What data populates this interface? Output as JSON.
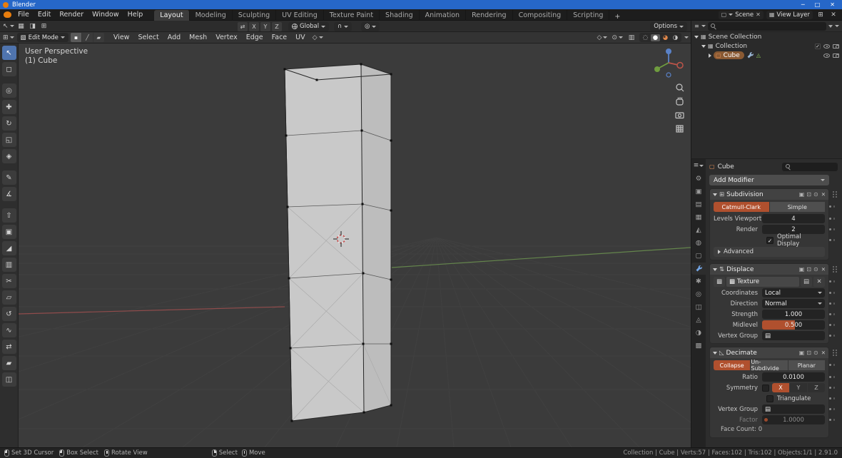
{
  "window": {
    "title": "Blender"
  },
  "icons": {
    "minimize": "─",
    "maximize": "□",
    "close": "✕",
    "check": "✓",
    "editor_menu": "≡",
    "editor_3d": "⊞",
    "collection": "▦",
    "object": "▢",
    "mesh_data": "◬",
    "mode_cube": "▧",
    "select_modes": [
      "▪",
      "╱",
      "▰"
    ],
    "mirror_tool": "⇄",
    "magnet": "∩",
    "proportional": "◎",
    "gizmo": "◇",
    "overlay": "⊙",
    "xray": "▥",
    "shading": [
      "◌",
      "●",
      "◕",
      "◑"
    ],
    "ts_icons": [
      "▦",
      "◨",
      "⊞"
    ],
    "tb_extra": [
      "▢",
      "▦"
    ],
    "tools": [
      "↖",
      "◻",
      "◎",
      "✚",
      "↻",
      "◱",
      "◈",
      "✎",
      "∡",
      "⇧",
      "▣",
      "◢",
      "▥",
      "✂",
      "▱",
      "↺",
      "∿",
      "⇄",
      "▰",
      "◫"
    ],
    "props_tabs": [
      "⚙",
      "▣",
      "▤",
      "▦",
      "◭",
      "◍",
      "▢",
      "✱",
      "◎",
      "◫",
      "◬",
      "◑",
      "▩"
    ],
    "mod_subsurf": "⊞",
    "mod_displace": "⇅",
    "mod_decimate": "◺",
    "toggle_edit": "▣",
    "toggle_realtime": "⊡",
    "toggle_render": "⊙",
    "vgroup": "▤",
    "checker": "▩",
    "paper": "▤"
  },
  "topbar": {
    "menus": [
      "File",
      "Edit",
      "Render",
      "Window",
      "Help"
    ],
    "workspaces": [
      "Layout",
      "Modeling",
      "Sculpting",
      "UV Editing",
      "Texture Paint",
      "Shading",
      "Animation",
      "Rendering",
      "Compositing",
      "Scripting"
    ],
    "add_workspace": "+",
    "scene_label": "Scene",
    "view_layer_label": "View Layer"
  },
  "tool_settings": {
    "mirror_axes": [
      "X",
      "Y",
      "Z"
    ],
    "orientation": "Global",
    "options_label": "Options"
  },
  "viewport_header": {
    "mode": "Edit Mode",
    "menus": [
      "View",
      "Select",
      "Add",
      "Mesh",
      "Vertex",
      "Edge",
      "Face",
      "UV"
    ]
  },
  "viewport": {
    "overlay_title": "User Perspective",
    "overlay_object": "(1) Cube"
  },
  "outliner": {
    "rows": [
      {
        "label": "Scene Collection"
      },
      {
        "label": "Collection"
      },
      {
        "label": "Cube"
      }
    ]
  },
  "properties": {
    "breadcrumb_object": "Cube",
    "add_modifier": "Add Modifier",
    "subdivision": {
      "name": "Subdivision",
      "type_catmull": "Catmull-Clark",
      "type_simple": "Simple",
      "levels_label": "Levels Viewport",
      "levels_value": "4",
      "render_label": "Render",
      "render_value": "2",
      "optimal_label": "Optimal Display",
      "advanced_label": "Advanced"
    },
    "displace": {
      "name": "Displace",
      "texture_value": "Texture",
      "coordinates_label": "Coordinates",
      "coordinates_value": "Local",
      "direction_label": "Direction",
      "direction_value": "Normal",
      "strength_label": "Strength",
      "strength_value": "1.000",
      "midlevel_label": "Midlevel",
      "midlevel_value": "0.500",
      "vertex_group_label": "Vertex Group"
    },
    "decimate": {
      "name": "Decimate",
      "mode_collapse": "Collapse",
      "mode_unsubdivide": "Un-Subdivide",
      "mode_planar": "Planar",
      "ratio_label": "Ratio",
      "ratio_value": "0.0100",
      "symmetry_label": "Symmetry",
      "axis_x": "X",
      "axis_y": "Y",
      "axis_z": "Z",
      "triangulate_label": "Triangulate",
      "vertex_group_label": "Vertex Group",
      "factor_label": "Factor",
      "factor_value": "1.0000",
      "face_count": "Face Count: 0"
    }
  },
  "statusbar": {
    "hint_cursor": "Set 3D Cursor",
    "hint_box_select": "Box Select",
    "hint_rotate": "Rotate View",
    "hint_select": "Select",
    "hint_move": "Move",
    "stats": "Collection | Cube | Verts:57 | Faces:102 | Tris:102 | Objects:1/1 | 2.91.0"
  }
}
